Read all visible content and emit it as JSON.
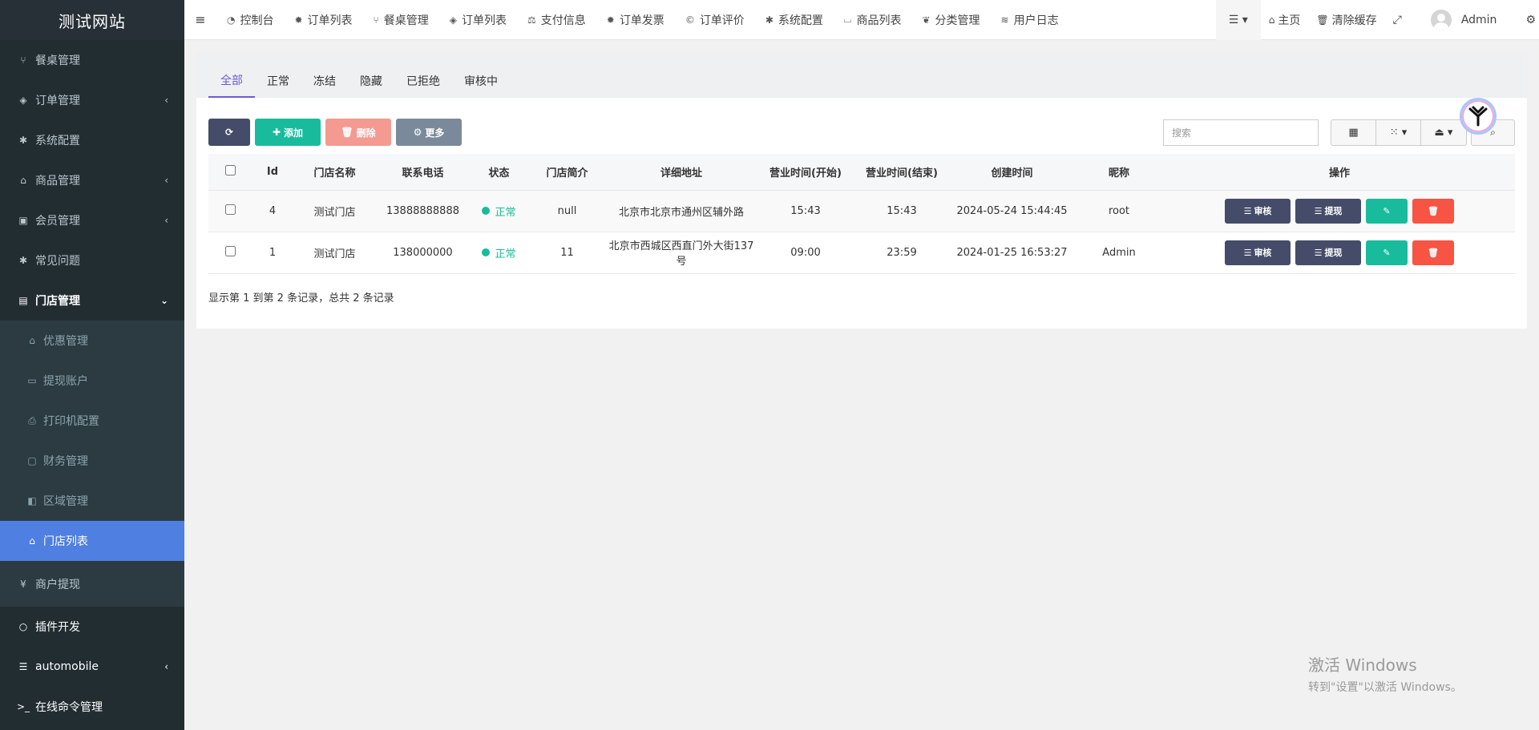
{
  "site": {
    "title": "测试网站"
  },
  "sidebar": {
    "items": [
      {
        "label": "餐桌管理",
        "icon": "cutlery-icon"
      },
      {
        "label": "订单管理",
        "icon": "cube-icon",
        "has_children": true
      },
      {
        "label": "系统配置",
        "icon": "asterisk-icon"
      },
      {
        "label": "商品管理",
        "icon": "gift-icon",
        "has_children": true
      },
      {
        "label": "会员管理",
        "icon": "id-card-icon",
        "has_children": true
      },
      {
        "label": "常见问题",
        "icon": "asterisk-icon"
      },
      {
        "label": "门店管理",
        "icon": "archive-icon",
        "expanded": true
      }
    ],
    "subitems": [
      {
        "label": "优惠管理",
        "icon": "gift-icon"
      },
      {
        "label": "提现账户",
        "icon": "keyboard-icon"
      },
      {
        "label": "打印机配置",
        "icon": "print-icon"
      },
      {
        "label": "财务管理",
        "icon": "money-icon"
      },
      {
        "label": "区域管理",
        "icon": "map-icon"
      },
      {
        "label": "门店列表",
        "icon": "bank-icon",
        "active": true
      }
    ],
    "after_sub": {
      "label": "商户提现",
      "icon": "yen-icon"
    },
    "bottom": [
      {
        "label": "插件开发",
        "icon": "circle-icon"
      },
      {
        "label": "automobile",
        "icon": "list-icon",
        "has_children": true
      },
      {
        "label": "在线命令管理",
        "icon": "terminal-icon"
      }
    ]
  },
  "topnav": {
    "tabs": [
      {
        "label": "控制台",
        "icon": "dashboard-icon"
      },
      {
        "label": "订单列表",
        "icon": "gear-icon"
      },
      {
        "label": "餐桌管理",
        "icon": "cutlery-icon"
      },
      {
        "label": "订单列表",
        "icon": "cube-icon"
      },
      {
        "label": "支付信息",
        "icon": "balance-scale-icon"
      },
      {
        "label": "订单发票",
        "icon": "gear-icon"
      },
      {
        "label": "订单评价",
        "icon": "copyright-icon"
      },
      {
        "label": "系统配置",
        "icon": "asterisk-icon"
      },
      {
        "label": "商品列表",
        "icon": "basket-icon"
      },
      {
        "label": "分类管理",
        "icon": "leaf-icon"
      },
      {
        "label": "用户日志",
        "icon": "history-icon"
      }
    ],
    "home_label": "主页",
    "clear_cache_label": "清除缓存",
    "user_name": "Admin"
  },
  "panel": {
    "tabs": [
      "全部",
      "正常",
      "冻结",
      "隐藏",
      "已拒绝",
      "审核中"
    ],
    "active_tab": "全部",
    "toolbar": {
      "add_label": "添加",
      "delete_label": "删除",
      "more_label": "更多"
    },
    "search_placeholder": "搜索"
  },
  "table": {
    "columns": [
      "Id",
      "门店名称",
      "联系电话",
      "状态",
      "门店简介",
      "详细地址",
      "营业时间(开始)",
      "营业时间(结束)",
      "创建时间",
      "昵称",
      "操作"
    ],
    "rows": [
      {
        "id": "4",
        "name": "测试门店",
        "phone": "13888888888",
        "status": "正常",
        "intro": "null",
        "address": "北京市北京市通州区辅外路",
        "open": "15:43",
        "close": "15:43",
        "created": "2024-05-24 15:44:45",
        "nickname": "root"
      },
      {
        "id": "1",
        "name": "测试门店",
        "phone": "138000000",
        "status": "正常",
        "intro": "11",
        "address": "北京市西城区西直门外大街137号",
        "open": "09:00",
        "close": "23:59",
        "created": "2024-01-25 16:53:27",
        "nickname": "Admin"
      }
    ],
    "ops": {
      "audit": "审核",
      "withdraw": "提现"
    }
  },
  "pager": {
    "summary": "显示第 1 到第 2 条记录，总共 2 条记录"
  },
  "watermark": {
    "line1": "激活 Windows",
    "line2": "转到\"设置\"以激活 Windows。"
  },
  "colors": {
    "sidebar_bg": "#222d32",
    "active_menu": "#4f7fe0",
    "primary_dark": "#444c69",
    "success": "#18bc9c",
    "danger": "#f75444",
    "tab_active": "#6f5ad4"
  }
}
